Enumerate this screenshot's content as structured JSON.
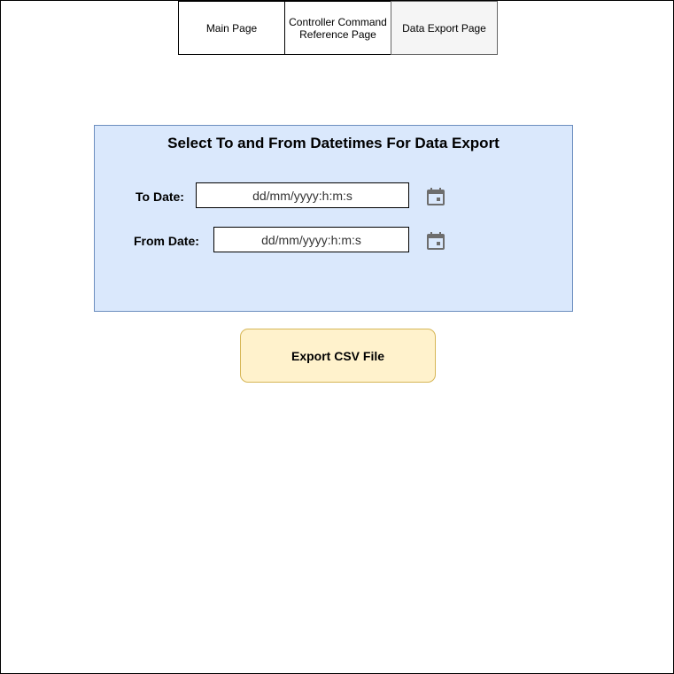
{
  "tabs": [
    {
      "label": "Main Page"
    },
    {
      "label": "Controller Command Reference Page"
    },
    {
      "label": "Data Export Page"
    }
  ],
  "panel": {
    "title": "Select To and From Datetimes For Data Export",
    "to_date": {
      "label": "To Date:",
      "value": "dd/mm/yyyy:h:m:s",
      "icon": "calendar-icon"
    },
    "from_date": {
      "label": "From Date:",
      "value": "dd/mm/yyyy:h:m:s",
      "icon": "calendar-icon"
    }
  },
  "export_button": {
    "label": "Export CSV File"
  },
  "colors": {
    "panel_fill": "#dae8fc",
    "panel_border": "#6c8ebf",
    "button_fill": "#fff2cc",
    "button_border": "#d6b656",
    "active_tab_fill": "#f5f5f5",
    "icon_gray": "#6d6d6d"
  }
}
